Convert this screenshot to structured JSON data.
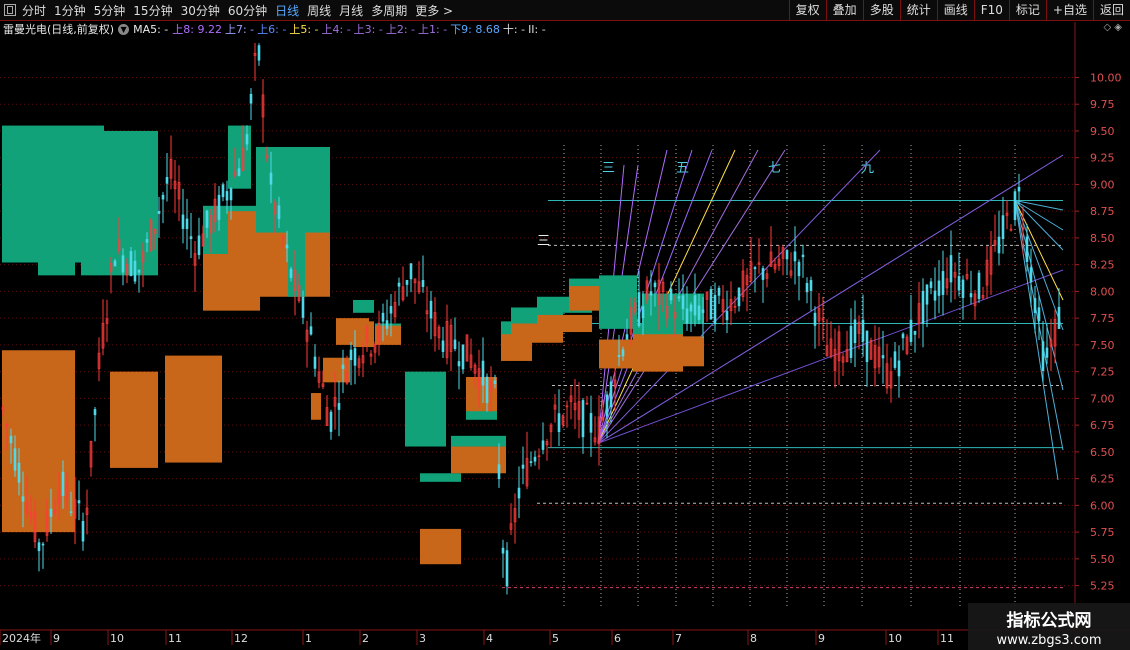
{
  "toolbar": {
    "periods": [
      "分时",
      "1分钟",
      "5分钟",
      "15分钟",
      "30分钟",
      "60分钟",
      "日线",
      "周线",
      "月线",
      "多周期",
      "更多 >"
    ],
    "active_period": "日线",
    "buttons": [
      "复权",
      "叠加",
      "多股",
      "统计",
      "画线",
      "F10",
      "标记",
      "+自选",
      "返回"
    ]
  },
  "info": {
    "stock_name": "雷曼光电(日线,前复权)",
    "ma_label": "MA5: -",
    "levels": [
      {
        "text": "上8: 9.22",
        "color": "#b06cff"
      },
      {
        "text": "上7: -",
        "color": "#9aa0ff"
      },
      {
        "text": "上6: -",
        "color": "#5a8cff"
      },
      {
        "text": "上5: -",
        "color": "#ffe04a"
      },
      {
        "text": "上4: -",
        "color": "#a070e0"
      },
      {
        "text": "上3: -",
        "color": "#a070e0"
      },
      {
        "text": "上2: -",
        "color": "#a070e0"
      },
      {
        "text": "上1: -",
        "color": "#a070e0"
      },
      {
        "text": "下9: 8.68",
        "color": "#59a8ff"
      },
      {
        "text": "十: -",
        "color": "#dddddd"
      },
      {
        "text": "II: -",
        "color": "#dddddd"
      }
    ],
    "right_icons": "◇ ◈"
  },
  "chart_data": {
    "type": "candlestick",
    "title": "雷曼光电(日线,前复权)",
    "price_axis": {
      "ticks": [
        5.25,
        5.5,
        5.75,
        6.0,
        6.25,
        6.5,
        6.75,
        7.0,
        7.25,
        7.5,
        7.75,
        8.0,
        8.25,
        8.5,
        8.75,
        9.0,
        9.25,
        9.5,
        9.75,
        10.0
      ],
      "range": [
        5.05,
        10.35
      ],
      "side": "right"
    },
    "time_axis": {
      "labels": [
        "2024年",
        "9",
        "10",
        "11",
        "12",
        "1",
        "2",
        "3",
        "4",
        "5",
        "6",
        "7",
        "8",
        "9",
        "10",
        "11"
      ]
    },
    "vertical_marks": [
      "三",
      "五",
      "七",
      "九"
    ],
    "horizontal_mark": "三",
    "horizontal_levels": [
      8.85,
      8.43,
      7.7,
      7.12,
      6.54,
      6.02,
      5.25
    ],
    "fan_origin": {
      "date_index": 23,
      "price": 6.58
    },
    "fan_origin_right": {
      "date_index": 50,
      "price": 8.85
    },
    "boxes": [
      {
        "from": 0,
        "to": 1,
        "low": 5.75,
        "high": 7.45,
        "kind": "down"
      },
      {
        "from": 0,
        "to": 0,
        "low": 8.27,
        "high": 9.55,
        "kind": "up"
      },
      {
        "from": 1,
        "to": 1,
        "low": 8.15,
        "high": 9.5,
        "kind": "up"
      },
      {
        "from": 2,
        "to": 3,
        "low": 8.15,
        "high": 9.5,
        "kind": "up"
      },
      {
        "from": 3,
        "to": 3,
        "low": 6.35,
        "high": 7.25,
        "kind": "down"
      },
      {
        "from": 4,
        "to": 4,
        "low": 6.4,
        "high": 7.4,
        "kind": "down"
      },
      {
        "from": 5,
        "to": 5,
        "low": 8.25,
        "high": 8.8,
        "kind": "up"
      },
      {
        "from": 5,
        "to": 5,
        "low": 7.82,
        "high": 8.35,
        "kind": "down"
      },
      {
        "from": 6,
        "to": 7,
        "low": 7.95,
        "high": 8.75,
        "kind": "down"
      },
      {
        "from": 6,
        "to": 6,
        "low": 8.96,
        "high": 9.55,
        "kind": "up"
      },
      {
        "from": 7,
        "to": 7,
        "low": 8.8,
        "high": 9.35,
        "kind": "up"
      },
      {
        "from": 7,
        "to": 7,
        "low": 8.55,
        "high": 9.3,
        "kind": "up"
      },
      {
        "from": 8,
        "to": 8,
        "low": 7.95,
        "high": 8.78,
        "kind": "up"
      },
      {
        "from": 9,
        "to": 9,
        "low": 6.8,
        "high": 7.05,
        "kind": "down"
      },
      {
        "from": 10,
        "to": 10,
        "low": 7.2,
        "high": 7.32,
        "kind": "up"
      },
      {
        "from": 10,
        "to": 10,
        "low": 7.15,
        "high": 7.38,
        "kind": "down"
      },
      {
        "from": 11,
        "to": 11,
        "low": 7.55,
        "high": 7.72,
        "kind": "up"
      },
      {
        "from": 11,
        "to": 11,
        "low": 7.5,
        "high": 7.75,
        "kind": "down"
      },
      {
        "from": 12,
        "to": 12,
        "low": 7.8,
        "high": 7.92,
        "kind": "up"
      },
      {
        "from": 12,
        "to": 12,
        "low": 7.48,
        "high": 7.72,
        "kind": "down"
      },
      {
        "from": 13,
        "to": 13,
        "low": 7.55,
        "high": 7.7,
        "kind": "up"
      },
      {
        "from": 13,
        "to": 13,
        "low": 7.5,
        "high": 7.68,
        "kind": "down"
      },
      {
        "from": 14,
        "to": 14,
        "low": 6.55,
        "high": 7.25,
        "kind": "up"
      },
      {
        "from": 15,
        "to": 15,
        "low": 6.22,
        "high": 6.3,
        "kind": "up"
      },
      {
        "from": 15,
        "to": 15,
        "low": 5.45,
        "high": 5.78,
        "kind": "down"
      },
      {
        "from": 16,
        "to": 16,
        "low": 6.55,
        "high": 6.65,
        "kind": "up"
      },
      {
        "from": 16,
        "to": 16,
        "low": 6.3,
        "high": 6.55,
        "kind": "down"
      },
      {
        "from": 17,
        "to": 17,
        "low": 6.8,
        "high": 6.92,
        "kind": "up"
      },
      {
        "from": 17,
        "to": 17,
        "low": 6.88,
        "high": 7.2,
        "kind": "down"
      },
      {
        "from": 18,
        "to": 18,
        "low": 7.55,
        "high": 7.72,
        "kind": "up"
      },
      {
        "from": 18,
        "to": 18,
        "low": 7.35,
        "high": 7.6,
        "kind": "down"
      },
      {
        "from": 19,
        "to": 19,
        "low": 7.7,
        "high": 7.85,
        "kind": "up"
      },
      {
        "from": 19,
        "to": 19,
        "low": 7.52,
        "high": 7.7,
        "kind": "down"
      },
      {
        "from": 20,
        "to": 20,
        "low": 7.8,
        "high": 7.95,
        "kind": "up"
      },
      {
        "from": 20,
        "to": 20,
        "low": 7.62,
        "high": 7.78,
        "kind": "down"
      },
      {
        "from": 21,
        "to": 21,
        "low": 7.95,
        "high": 8.12,
        "kind": "up"
      },
      {
        "from": 21,
        "to": 21,
        "low": 7.82,
        "high": 8.05,
        "kind": "down"
      },
      {
        "from": 22,
        "to": 22,
        "low": 7.65,
        "high": 8.15,
        "kind": "up"
      },
      {
        "from": 22,
        "to": 22,
        "low": 7.28,
        "high": 7.55,
        "kind": "down"
      },
      {
        "from": 23,
        "to": 23,
        "low": 7.52,
        "high": 7.7,
        "kind": "up"
      },
      {
        "from": 23,
        "to": 23,
        "low": 7.25,
        "high": 7.6,
        "kind": "down"
      },
      {
        "from": 24,
        "to": 24,
        "low": 7.3,
        "high": 7.58,
        "kind": "down"
      },
      {
        "from": 24,
        "to": 24,
        "low": 7.7,
        "high": 7.98,
        "kind": "up"
      }
    ]
  },
  "watermark": {
    "line1": "指标公式网",
    "line2": "www.zbgs3.com"
  }
}
